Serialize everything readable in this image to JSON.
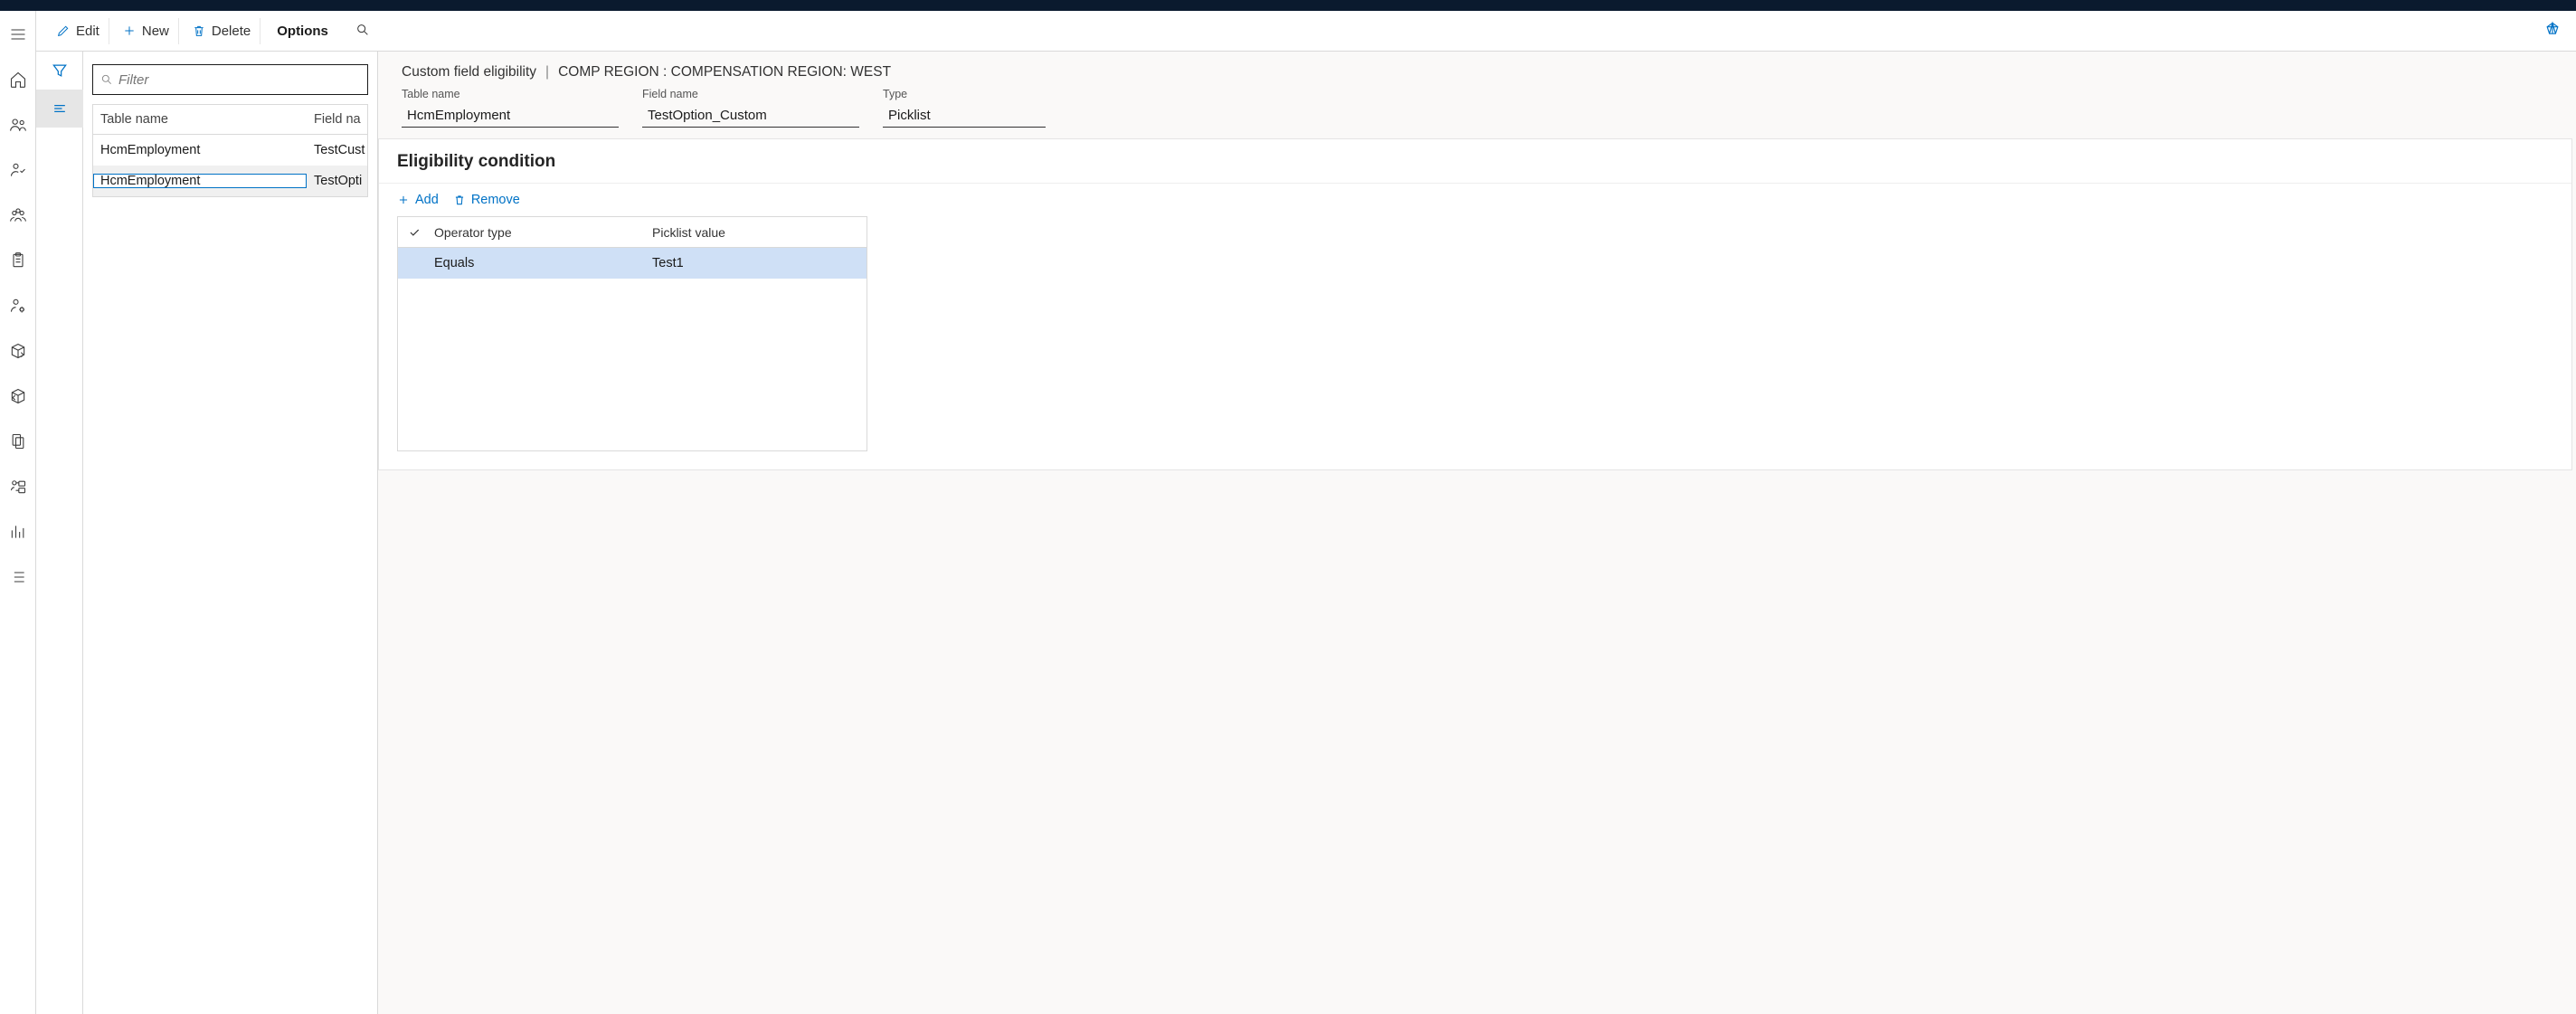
{
  "commands": {
    "edit": "Edit",
    "new": "New",
    "delete": "Delete",
    "options": "Options"
  },
  "list": {
    "filter_placeholder": "Filter",
    "columns": {
      "c1": "Table name",
      "c2": "Field na"
    },
    "rows": [
      {
        "table": "HcmEmployment",
        "field": "TestCust"
      },
      {
        "table": "HcmEmployment",
        "field": "TestOpti"
      }
    ]
  },
  "detail": {
    "crumb1": "Custom field eligibility",
    "crumb2": "COMP REGION : COMPENSATION REGION: WEST",
    "fields": {
      "table_label": "Table name",
      "table_value": "HcmEmployment",
      "field_label": "Field name",
      "field_value": "TestOption_Custom",
      "type_label": "Type",
      "type_value": "Picklist"
    },
    "section_title": "Eligibility condition",
    "add_label": "Add",
    "remove_label": "Remove",
    "cond_columns": {
      "op": "Operator type",
      "val": "Picklist value"
    },
    "cond_rows": [
      {
        "op": "Equals",
        "val": "Test1"
      }
    ]
  }
}
